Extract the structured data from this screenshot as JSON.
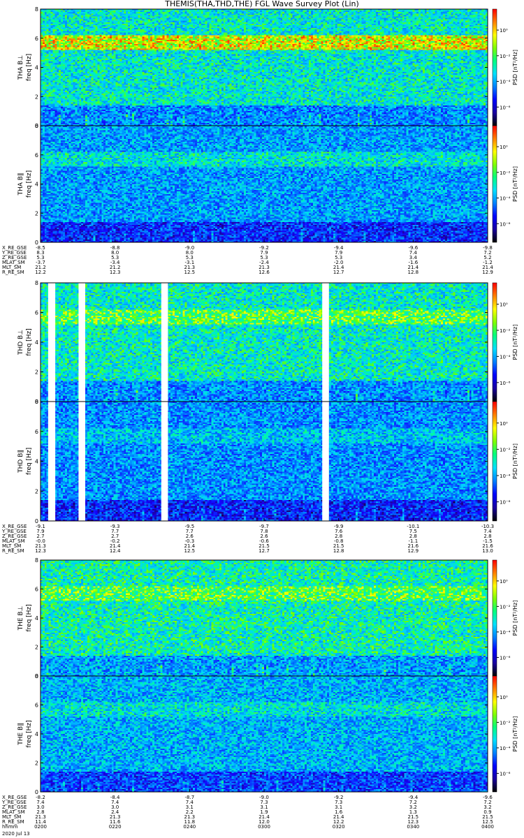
{
  "title": "THEMIS(THA,THD,THE) FGL Wave Survey Plot (Lin)",
  "date_label": "2020 Jul 13",
  "colorbar": {
    "label": "PSD [nT²/Hz]",
    "ticks": [
      "10⁰",
      "10⁻²",
      "10⁻⁴",
      "10⁻⁶"
    ],
    "colormap": [
      "#000000",
      "#1a00a0",
      "#0000ff",
      "#0080ff",
      "#00e0ff",
      "#00ff80",
      "#80ff00",
      "#ffff00",
      "#ff8000",
      "#ff0000"
    ]
  },
  "chart_data": [
    {
      "type": "heatmap",
      "name": "THA B⊥",
      "ylabel": "THA B⊥\nfreq [Hz]",
      "ylim": [
        0,
        8
      ],
      "yticks": [
        "0",
        "2",
        "4",
        "6",
        "8"
      ],
      "level": 0.55,
      "band_6hz": 0.25,
      "gaps": [],
      "description_free": true
    },
    {
      "type": "heatmap",
      "name": "THA B∥",
      "ylabel": "THA B∥\nfreq [Hz]",
      "ylim": [
        0,
        8
      ],
      "yticks": [
        "0",
        "2",
        "4",
        "6",
        "8"
      ],
      "level": 0.42,
      "band_6hz": 0.12,
      "gaps": []
    },
    {
      "type": "heatmap",
      "name": "THD B⊥",
      "ylabel": "THD B⊥\nfreq [Hz]",
      "ylim": [
        0,
        8
      ],
      "yticks": [
        "0",
        "2",
        "4",
        "6",
        "8"
      ],
      "level": 0.56,
      "band_6hz": 0.12,
      "gaps": [
        [
          0.017,
          0.033
        ],
        [
          0.085,
          0.1
        ],
        [
          0.27,
          0.285
        ],
        [
          0.63,
          0.645
        ]
      ]
    },
    {
      "type": "heatmap",
      "name": "THD B∥",
      "ylabel": "THD B∥\nfreq [Hz]",
      "ylim": [
        0,
        8
      ],
      "yticks": [
        "0",
        "2",
        "4",
        "6",
        "8"
      ],
      "level": 0.4,
      "band_6hz": 0.08,
      "gaps": [
        [
          0.017,
          0.033
        ],
        [
          0.085,
          0.1
        ],
        [
          0.27,
          0.285
        ],
        [
          0.63,
          0.645
        ]
      ]
    },
    {
      "type": "heatmap",
      "name": "THE B⊥",
      "ylabel": "THE B⊥\nfreq [Hz]",
      "ylim": [
        0,
        8
      ],
      "yticks": [
        "0",
        "2",
        "4",
        "6",
        "8"
      ],
      "level": 0.58,
      "band_6hz": 0.1,
      "gaps": []
    },
    {
      "type": "heatmap",
      "name": "THE B∥",
      "ylabel": "THE B∥\nfreq [Hz]",
      "ylim": [
        0,
        8
      ],
      "yticks": [
        "0",
        "2",
        "4",
        "6",
        "8"
      ],
      "level": 0.45,
      "band_6hz": 0.08,
      "gaps": []
    }
  ],
  "annotations": [
    {
      "rows": [
        "X_RE_GSE",
        "Y_RE_GSE",
        "Z_RE_GSE",
        "MLAT_SM",
        "MLT_SM",
        "R_RE_SM"
      ],
      "columns": [
        [
          "-8.5",
          "8.3",
          "5.3",
          "-3.7",
          "21.2",
          "12.2"
        ],
        [
          "-8.8",
          "8.0",
          "5.3",
          "-3.4",
          "21.2",
          "12.3"
        ],
        [
          "-9.0",
          "8.0",
          "5.3",
          "-3.1",
          "21.3",
          "12.5"
        ],
        [
          "-9.2",
          "7.9",
          "5.3",
          "-2.4",
          "21.3",
          "12.6"
        ],
        [
          "-9.4",
          "7.9",
          "5.3",
          "-2.0",
          "21.4",
          "12.7"
        ],
        [
          "-9.6",
          "7.4",
          "3.4",
          "-1.6",
          "21.4",
          "12.8"
        ],
        [
          "-9.8",
          "7.2",
          "5.2",
          "-1.2",
          "21.4",
          "12.9"
        ]
      ]
    },
    {
      "rows": [
        "X_RE_GSE",
        "Y_RE_GSE",
        "Z_RE_GSE",
        "MLAT_SM",
        "MLT_SM",
        "R_RE_SM"
      ],
      "columns": [
        [
          "-9.1",
          "7.9",
          "2.7",
          "-0.0",
          "21.3",
          "12.3"
        ],
        [
          "-9.3",
          "7.7",
          "2.7",
          "-0.2",
          "21.4",
          "12.4"
        ],
        [
          "-9.5",
          "7.7",
          "2.6",
          "-0.3",
          "21.4",
          "12.5"
        ],
        [
          "-9.7",
          "7.8",
          "2.6",
          "-0.6",
          "21.5",
          "12.7"
        ],
        [
          "-9.9",
          "7.6",
          "2.8",
          "-0.8",
          "21.5",
          "12.8"
        ],
        [
          "-10.1",
          "7.5",
          "2.8",
          "-1.1",
          "21.6",
          "12.9"
        ],
        [
          "-10.3",
          "7.4",
          "2.8",
          "-1.5",
          "21.6",
          "13.0"
        ]
      ]
    },
    {
      "rows": [
        "X_RE_GSE",
        "Y_RE_GSE",
        "Z_RE_GSE",
        "MLAT_SM",
        "MLT_SM",
        "R_RE_SM",
        "hhmm"
      ],
      "columns": [
        [
          "-8.2",
          "7.4",
          "3.0",
          "2.8",
          "21.3",
          "11.4",
          "0200"
        ],
        [
          "-8.4",
          "7.4",
          "3.0",
          "2.4",
          "21.3",
          "11.6",
          "0220"
        ],
        [
          "-8.7",
          "7.4",
          "3.1",
          "2.2",
          "21.3",
          "11.8",
          "0240"
        ],
        [
          "-9.0",
          "7.3",
          "3.1",
          "1.9",
          "21.4",
          "12.0",
          "0300"
        ],
        [
          "-9.2",
          "7.3",
          "3.1",
          "1.6",
          "21.4",
          "12.2",
          "0320"
        ],
        [
          "-9.4",
          "7.2",
          "3.2",
          "1.3",
          "21.5",
          "12.3",
          "0340"
        ],
        [
          "-9.6",
          "7.2",
          "3.2",
          "0.9",
          "21.5",
          "12.5",
          "0400"
        ]
      ]
    }
  ]
}
